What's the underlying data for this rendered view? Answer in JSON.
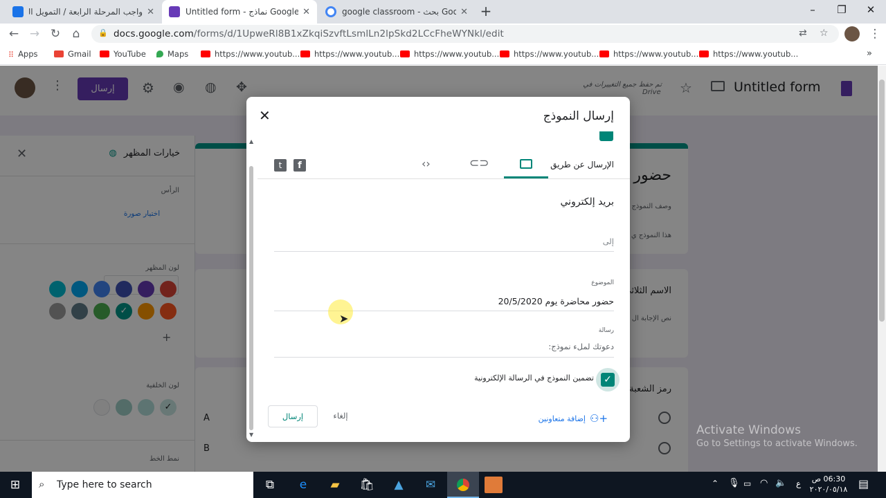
{
  "browser": {
    "tabs": [
      {
        "title": "واجب المرحلة الرابعة / التمويل الدو",
        "color": "#1a73e8"
      },
      {
        "title": "Untitled form - نماذج Google",
        "color": "#673ab7"
      },
      {
        "title": "google classroom - بحث Google",
        "color": "#4285f4"
      }
    ],
    "url_prefix": "docs.google.com",
    "url_rest": "/forms/d/1UpweRl8B1xZkqiSzvftLsmlLn2lpSkd2LCcFheWYNkl/edit",
    "bookmarks": [
      {
        "label": "Apps",
        "color": "#ea4335"
      },
      {
        "label": "Gmail",
        "color": "#ea4335"
      },
      {
        "label": "YouTube",
        "color": "#ff0000"
      },
      {
        "label": "Maps",
        "color": "#34a853"
      },
      {
        "label": "https://www.youtub...",
        "color": "#ff0000"
      },
      {
        "label": "https://www.youtub...",
        "color": "#ff0000"
      },
      {
        "label": "https://www.youtub...",
        "color": "#ff0000"
      },
      {
        "label": "https://www.youtub...",
        "color": "#ff0000"
      },
      {
        "label": "https://www.youtub...",
        "color": "#ff0000"
      },
      {
        "label": "https://www.youtub...",
        "color": "#ff0000"
      }
    ]
  },
  "forms_header": {
    "form_title": "Untitled form",
    "saved_status": "تم حفظ جميع التغييرات في",
    "saved_status_drive": "Drive",
    "send_label": "إرسال",
    "accent": "#673ab7"
  },
  "side_panel": {
    "title": "خيارات المظهر",
    "header_label": "الرأس",
    "choose_image": "اختيار صورة",
    "theme_color_label": "لون المظهر",
    "background_label": "لون الخلفية",
    "font_label": "نمط الخط",
    "theme_colors": [
      "#db4437",
      "#673ab7",
      "#3f51b5",
      "#4285f4",
      "#03a9f4",
      "#00bcd4",
      "#ff5722",
      "#ff9800",
      "#009688",
      "#4caf50",
      "#607d8b",
      "#9e9e9e"
    ],
    "background_colors": [
      "#c8e6e3",
      "#b2dfdb",
      "#9fd0c8",
      "#f5f5f5"
    ]
  },
  "form_body": {
    "title_partial": "حضور",
    "desc_partial": "وصف النموذج",
    "desc_partial2": "هذا النموذج ي",
    "q1_partial": "الاسم الثلاثي",
    "q1_hint": "نص الإجابة ال",
    "q2_partial": "رمز الشعبة",
    "option_a": "A",
    "option_b": "B"
  },
  "dialog": {
    "title": "إرسال النموذج",
    "send_via": "الإرسال عن طريق",
    "tabs": [
      "email-tab",
      "link-tab",
      "embed-tab"
    ],
    "section_title": "بريد إلكتروني",
    "to_placeholder": "إلى",
    "subject_label": "الموضوع",
    "subject_value": "حضور محاضرة يوم 20/5/2020",
    "message_label": "رسالة",
    "message_value": "دعوتك لملء نموذج:",
    "include_form": "تضمين النموذج في الرسالة الإلكترونية",
    "add_collaborators": "إضافة متعاونين",
    "cancel": "إلغاء",
    "send": "إرسال",
    "accent": "#008577"
  },
  "watermark": {
    "line1": "Activate Windows",
    "line2": "Go to Settings to activate Windows."
  },
  "taskbar": {
    "search_placeholder": "Type here to search",
    "time": "06:30 ص",
    "date": "٢٠٢٠/٠٥/١٨",
    "lang": "ع"
  }
}
